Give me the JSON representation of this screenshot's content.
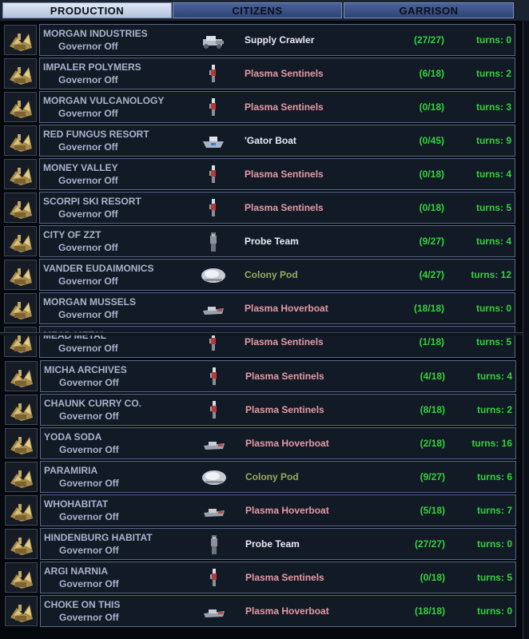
{
  "tabs": [
    {
      "label": "PRODUCTION",
      "active": true
    },
    {
      "label": "CITIZENS",
      "active": false
    },
    {
      "label": "GARRISON",
      "active": false
    }
  ],
  "colors": {
    "unit_default": "#e8ecf4",
    "unit_military": "#e49ba4",
    "unit_colony": "#9aaa5e",
    "progress": "#34d33c"
  },
  "rows": [
    {
      "city": "MORGAN INDUSTRIES",
      "governor": "Governor Off",
      "unit": "Supply Crawler",
      "unit_type": "crawler-icon",
      "unit_color": "default",
      "progress": "(27/27)",
      "turns": "turns:  0"
    },
    {
      "city": "IMPALER POLYMERS",
      "governor": "Governor Off",
      "unit": "Plasma Sentinels",
      "unit_type": "sentinel-icon",
      "unit_color": "military",
      "progress": "(6/18)",
      "turns": "turns:  2"
    },
    {
      "city": "MORGAN VULCANOLOGY",
      "governor": "Governor Off",
      "unit": "Plasma Sentinels",
      "unit_type": "sentinel-icon",
      "unit_color": "military",
      "progress": "(0/18)",
      "turns": "turns:  3"
    },
    {
      "city": "RED FUNGUS RESORT",
      "governor": "Governor Off",
      "unit": "'Gator Boat",
      "unit_type": "boat-icon",
      "unit_color": "default",
      "progress": "(0/45)",
      "turns": "turns:  9"
    },
    {
      "city": "MONEY VALLEY",
      "governor": "Governor Off",
      "unit": "Plasma Sentinels",
      "unit_type": "sentinel-icon",
      "unit_color": "military",
      "progress": "(0/18)",
      "turns": "turns:  4"
    },
    {
      "city": "SCORPI SKI RESORT",
      "governor": "Governor Off",
      "unit": "Plasma Sentinels",
      "unit_type": "sentinel-icon",
      "unit_color": "military",
      "progress": "(0/18)",
      "turns": "turns:  5"
    },
    {
      "city": "CITY OF ZZT",
      "governor": "Governor Off",
      "unit": "Probe Team",
      "unit_type": "probe-icon",
      "unit_color": "default",
      "progress": "(9/27)",
      "turns": "turns:  4"
    },
    {
      "city": "VANDER EUDAIMONICS",
      "governor": "Governor Off",
      "unit": "Colony Pod",
      "unit_type": "colony-pod-icon",
      "unit_color": "colony",
      "progress": "(4/27)",
      "turns": "turns:  12"
    },
    {
      "city": "MORGAN MUSSELS",
      "governor": "Governor Off",
      "unit": "Plasma Hoverboat",
      "unit_type": "hoverboat-icon",
      "unit_color": "military",
      "progress": "(18/18)",
      "turns": "turns:  0"
    },
    {
      "city": "MEAD METAL",
      "governor": "Governor Off",
      "unit": "Plasma Sentinels",
      "unit_type": "sentinel-icon",
      "unit_color": "military",
      "progress": "(1/18)",
      "turns": "turns:  5"
    },
    {
      "city": "MICHA ARCHIVES",
      "governor": "Governor Off",
      "unit": "Plasma Sentinels",
      "unit_type": "sentinel-icon",
      "unit_color": "military",
      "progress": "(4/18)",
      "turns": "turns:  4"
    },
    {
      "city": "CHAUNK CURRY CO.",
      "governor": "Governor Off",
      "unit": "Plasma Sentinels",
      "unit_type": "sentinel-icon",
      "unit_color": "military",
      "progress": "(8/18)",
      "turns": "turns:  2"
    },
    {
      "city": "YODA SODA",
      "governor": "Governor Off",
      "unit": "Plasma Hoverboat",
      "unit_type": "hoverboat-icon",
      "unit_color": "military",
      "progress": "(2/18)",
      "turns": "turns:  16"
    },
    {
      "city": "PARAMIRIA",
      "governor": "Governor Off",
      "unit": "Colony Pod",
      "unit_type": "colony-pod-icon",
      "unit_color": "colony",
      "progress": "(9/27)",
      "turns": "turns:  6"
    },
    {
      "city": "WHOHABITAT",
      "governor": "Governor Off",
      "unit": "Plasma Hoverboat",
      "unit_type": "hoverboat-icon",
      "unit_color": "military",
      "progress": "(5/18)",
      "turns": "turns:  7"
    },
    {
      "city": "HINDENBURG HABITAT",
      "governor": "Governor Off",
      "unit": "Probe Team",
      "unit_type": "probe-icon",
      "unit_color": "default",
      "progress": "(27/27)",
      "turns": "turns:  0"
    },
    {
      "city": "ARGI NARNIA",
      "governor": "Governor Off",
      "unit": "Plasma Sentinels",
      "unit_type": "sentinel-icon",
      "unit_color": "military",
      "progress": "(0/18)",
      "turns": "turns:  5"
    },
    {
      "city": "CHOKE ON THIS",
      "governor": "Governor Off",
      "unit": "Plasma Hoverboat",
      "unit_type": "hoverboat-icon",
      "unit_color": "military",
      "progress": "(18/18)",
      "turns": "turns:  0"
    }
  ]
}
